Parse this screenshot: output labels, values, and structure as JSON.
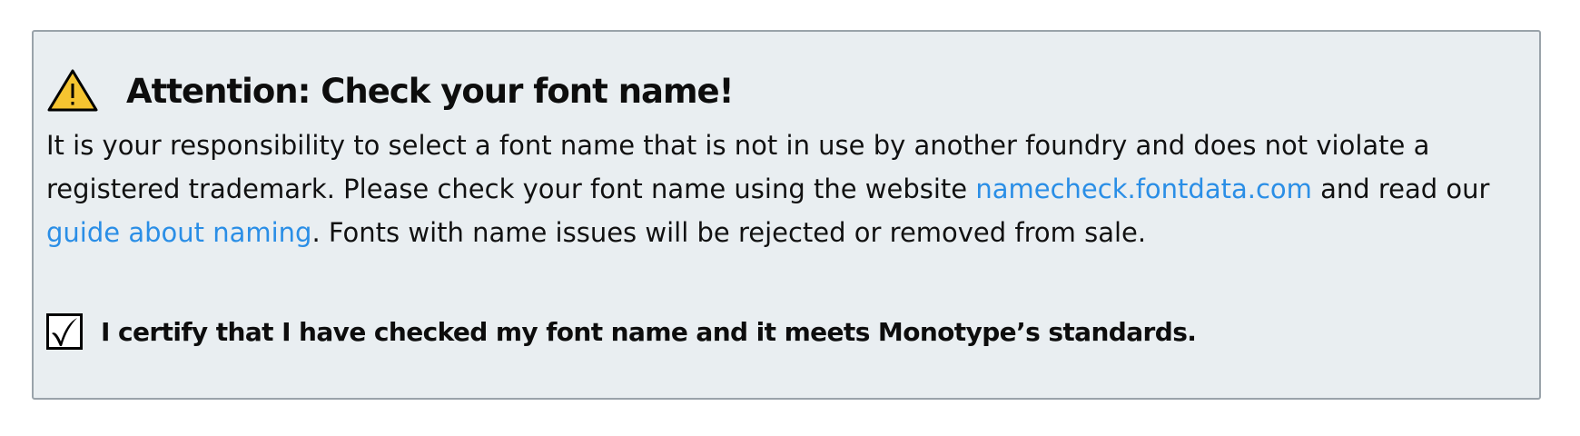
{
  "notice": {
    "title": "Attention: Check your font name!",
    "icon": "warning-triangle-icon",
    "accent_color": "#f5c430",
    "background_color": "#e9eef1",
    "link_color": "#2a8ee6",
    "body": {
      "part1": "It is your responsibility to select a font name that is not in use by another foundry and does not violate a registered trademark. Please check your font name using the website ",
      "link1": "namecheck.fontdata.com",
      "part2": " and read our ",
      "link2": "guide about naming",
      "part3": ". Fonts with name issues will be rejected or removed from sale."
    }
  },
  "certify": {
    "checked": true,
    "check_icon": "checkmark-icon",
    "label": "I certify that I have checked my font name and it meets Monotype’s standards."
  }
}
